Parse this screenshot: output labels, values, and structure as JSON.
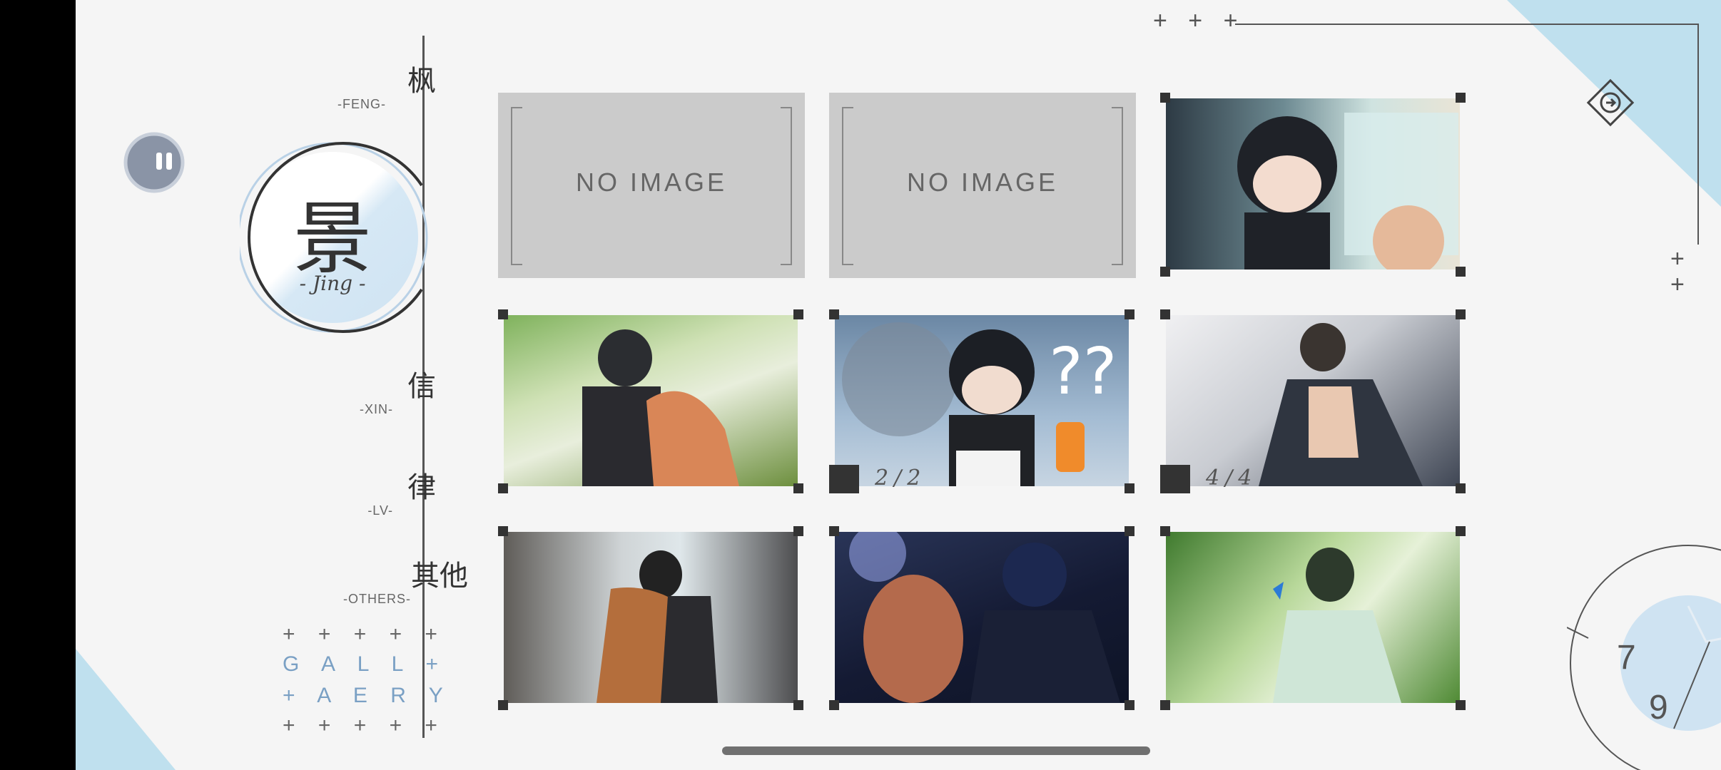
{
  "nav": {
    "feng": {
      "cn": "枫",
      "en": "-FENG-"
    },
    "jing": {
      "cn": "景",
      "en": "- Jing -"
    },
    "xin": {
      "cn": "信",
      "en": "-XIN-"
    },
    "lv": {
      "cn": "律",
      "en": "-LV-"
    },
    "others": {
      "cn": "其他",
      "en": "-OTHERS-"
    }
  },
  "gallery_deco": {
    "row1": "+ + + + +",
    "row2": "G A L L +",
    "row3": "+ A E R Y",
    "row4": "+ + + + +"
  },
  "grid": {
    "no_image_label": "NO   IMAGE",
    "card5_count": "2/2",
    "card6_count": "4/4"
  },
  "top_deco": {
    "plus_h": "+ + +",
    "plus_v1": "+",
    "plus_v2": "+"
  },
  "pager": {
    "current": "7",
    "total": "9"
  },
  "colors": {
    "accent_blue": "#bfe0ee",
    "gallery_text": "#7aa0c4"
  }
}
